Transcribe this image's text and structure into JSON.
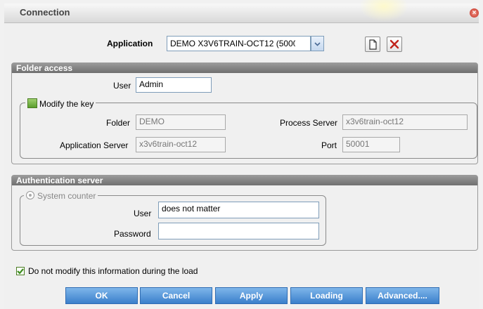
{
  "window": {
    "title": "Connection",
    "close_glyph": "×"
  },
  "application": {
    "label": "Application",
    "value": "DEMO X3V6TRAIN-OCT12 (5000"
  },
  "folder_access": {
    "header": "Folder access",
    "user_label": "User",
    "user_value": "Admin",
    "modify_key_label": "Modify the key",
    "folder_label": "Folder",
    "folder_value": "DEMO",
    "process_server_label": "Process Server",
    "process_server_value": "x3v6train-oct12",
    "app_server_label": "Application Server",
    "app_server_value": "x3v6train-oct12",
    "port_label": "Port",
    "port_value": "50001"
  },
  "auth": {
    "header": "Authentication server",
    "system_counter_label": "System counter",
    "user_label": "User",
    "user_value": "does not matter",
    "password_label": "Password",
    "password_value": ""
  },
  "options": {
    "no_modify_label": "Do not modify this information during the load"
  },
  "buttons": {
    "ok": "OK",
    "cancel": "Cancel",
    "apply": "Apply",
    "loading": "Loading",
    "advanced": "Advanced...."
  },
  "colors": {
    "accent": "#3a7fcb",
    "section_header": "#7a7a7a",
    "checkbox": "#6aa84f",
    "delete": "#c0221a"
  }
}
